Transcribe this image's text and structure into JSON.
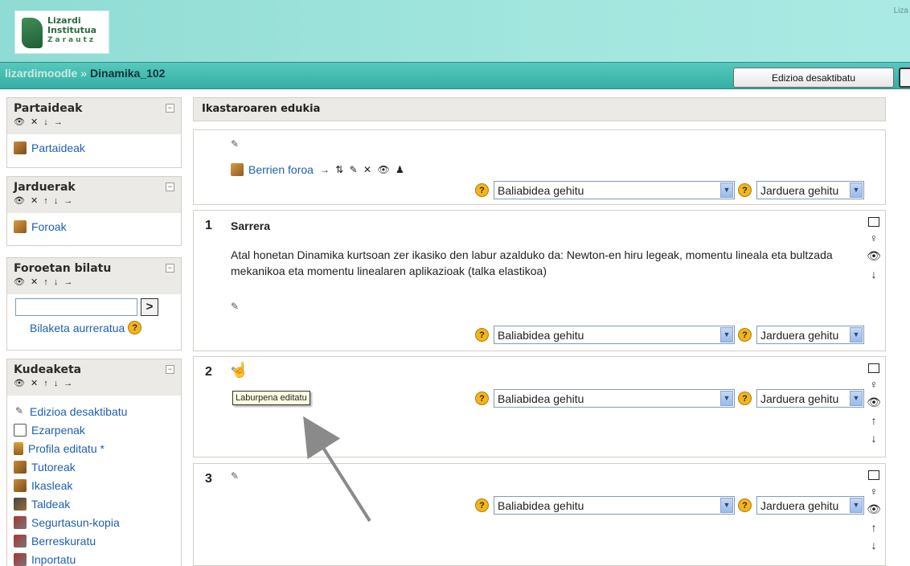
{
  "header": {
    "logo_lines": [
      "Lizardi",
      "Institutua",
      "Zarautz"
    ],
    "top_right_user": "Liza"
  },
  "navbar": {
    "home": "lizardimoodle",
    "separator": "»",
    "course": "Dinamika_102",
    "edit_button": "Edizioa desaktibatu"
  },
  "sidebar": {
    "participants": {
      "title": "Partaideak",
      "controls": "👁 ✕ ↓ →",
      "items": [
        {
          "label": "Partaideak",
          "icon": "people-icon"
        }
      ]
    },
    "activities": {
      "title": "Jarduerak",
      "controls": "👁 ✕ ↑ ↓ →",
      "items": [
        {
          "label": "Foroak",
          "icon": "forum-icon"
        }
      ]
    },
    "search": {
      "title": "Foroetan bilatu",
      "controls": "👁 ✕ ↑ ↓ →",
      "go": ">",
      "advanced": "Bilaketa aurreratua"
    },
    "admin": {
      "title": "Kudeaketa",
      "controls": "👁 ✕ ↑ ↓ →",
      "items": [
        {
          "label": "Edizioa desaktibatu",
          "icon": "pen-icon"
        },
        {
          "label": "Ezarpenak",
          "icon": "settings-doc-icon"
        },
        {
          "label": "Profila editatu *",
          "icon": "profile-icon"
        },
        {
          "label": "Tutoreak",
          "icon": "people-icon"
        },
        {
          "label": "Ikasleak",
          "icon": "people-icon"
        },
        {
          "label": "Taldeak",
          "icon": "groups-icon"
        },
        {
          "label": "Segurtasun-kopia",
          "icon": "backup-icon"
        },
        {
          "label": "Berreskuratu",
          "icon": "restore-icon"
        },
        {
          "label": "Inportatu",
          "icon": "import-icon"
        }
      ]
    }
  },
  "main": {
    "title": "Ikastaroaren edukia",
    "add_resource": "Baliabidea gehitu",
    "add_activity": "Jarduera gehitu",
    "section0": {
      "forum": "Berrien foroa",
      "controls": "→ ⇅ ✎ ✕ 👁 ♟"
    },
    "sections": [
      {
        "num": "1",
        "title": "Sarrera",
        "text": "Atal honetan Dinamika kurtsoan zer ikasiko den labur azalduko da: Newton-en hiru legeak, momentu lineala eta bultzada mekanikoa eta momentu linealaren aplikazioak (talka elastikoa)"
      },
      {
        "num": "2",
        "title": "",
        "text": ""
      },
      {
        "num": "3",
        "title": "",
        "text": ""
      }
    ],
    "tooltip": "Laburpena editatu"
  }
}
